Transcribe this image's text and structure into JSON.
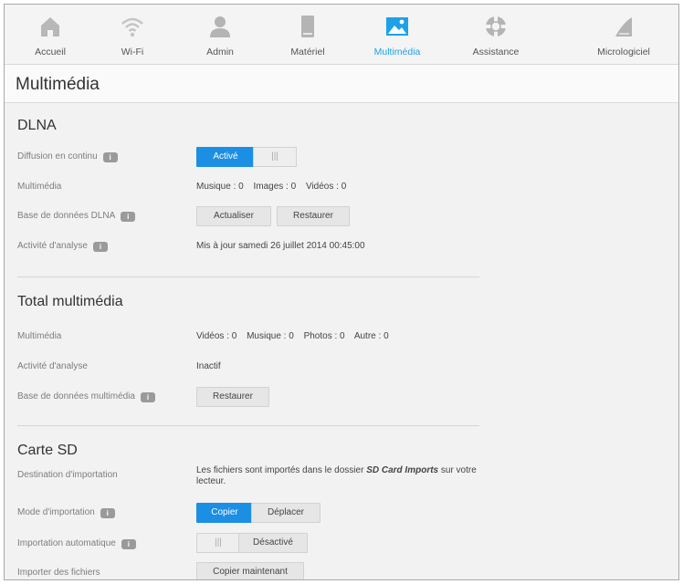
{
  "nav": [
    {
      "label": "Accueil",
      "icon": "home-icon"
    },
    {
      "label": "Wi-Fi",
      "icon": "wifi-icon"
    },
    {
      "label": "Admin",
      "icon": "user-icon"
    },
    {
      "label": "Matériel",
      "icon": "hardware-icon"
    },
    {
      "label": "Multimédia",
      "icon": "image-icon",
      "active": true
    },
    {
      "label": "Assistance",
      "icon": "lifebuoy-icon"
    },
    {
      "label": "Micrologiciel",
      "icon": "firmware-icon"
    }
  ],
  "page_title": "Multimédia",
  "dlna": {
    "title": "DLNA",
    "streaming_label": "Diffusion en continu",
    "streaming_on": "Activé",
    "streaming_toggle_off": "|||",
    "media_label": "Multimédia",
    "media_music": "Musique : 0",
    "media_images": "Images : 0",
    "media_videos": "Vidéos : 0",
    "db_label": "Base de données DLNA",
    "refresh_button": "Actualiser",
    "restore_button": "Restaurer",
    "scan_label": "Activité d'analyse",
    "scan_value": "Mis à jour samedi 26 juillet 2014 00:45:00"
  },
  "total": {
    "title": "Total multimédia",
    "media_label": "Multimédia",
    "videos": "Vidéos : 0",
    "music": "Musique : 0",
    "photos": "Photos : 0",
    "other": "Autre : 0",
    "scan_label": "Activité d'analyse",
    "scan_value": "Inactif",
    "db_label": "Base de données multimédia",
    "restore_button": "Restaurer"
  },
  "sd": {
    "title": "Carte SD",
    "dest_label": "Destination d'importation",
    "dest_text_1": "Les fichiers sont importés dans le dossier",
    "dest_folder": "SD Card Imports",
    "dest_text_2": "sur votre lecteur.",
    "mode_label": "Mode d'importation",
    "mode_copy": "Copier",
    "mode_move": "Déplacer",
    "auto_label": "Importation automatique",
    "auto_toggle_on": "|||",
    "auto_off": "Désactivé",
    "import_label": "Importer des fichiers",
    "import_button": "Copier maintenant"
  },
  "info_glyph": "i",
  "colors": {
    "accent": "#1b8fe3",
    "active_nav": "#1da1e8"
  }
}
